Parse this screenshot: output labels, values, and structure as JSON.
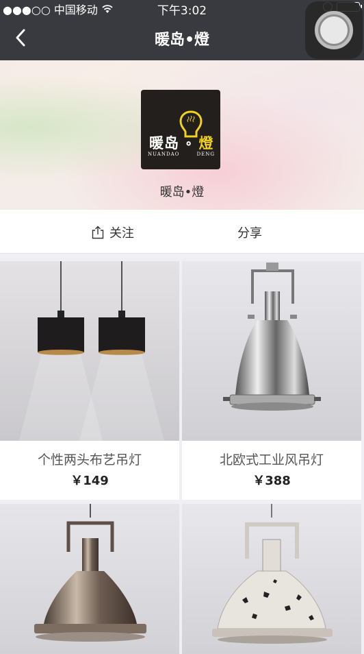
{
  "status_bar": {
    "carrier": "●●●○○ 中国移动",
    "time": "下午3:02"
  },
  "nav": {
    "title": "暖岛•燈",
    "back_icon": "chevron-left-icon"
  },
  "shop": {
    "logo_main": "暖岛",
    "logo_char": "燈",
    "logo_sub_left": "NUANDAO",
    "logo_sub_right": "DENG",
    "name": "暖岛•燈"
  },
  "actions": {
    "follow_label": "关注",
    "share_label": "分享"
  },
  "products": [
    {
      "title": "个性两头布艺吊灯",
      "price": "￥149"
    },
    {
      "title": "北欧式工业风吊灯",
      "price": "￥388"
    },
    {
      "title": "",
      "price": ""
    },
    {
      "title": "",
      "price": ""
    }
  ],
  "colors": {
    "nav_bg": "#393a3f",
    "logo_bg": "#231f1c",
    "bulb_yellow": "#f2d21b"
  }
}
